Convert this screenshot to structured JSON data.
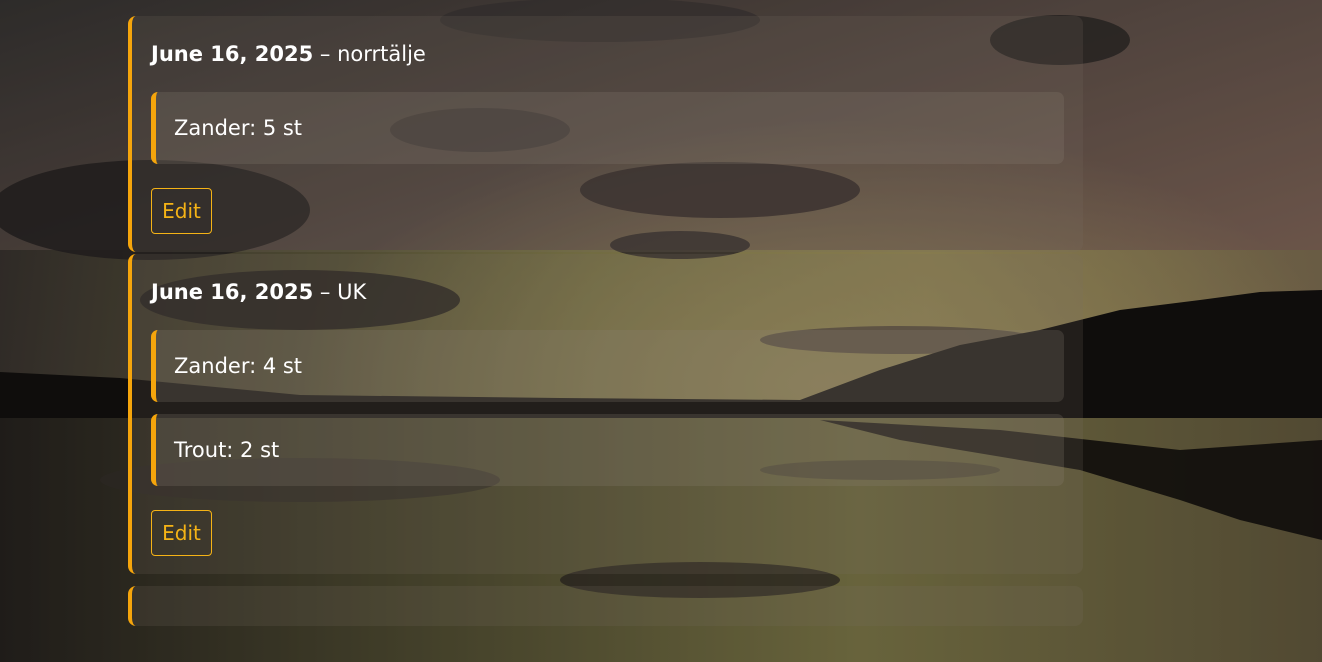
{
  "trips": [
    {
      "date": "June 16, 2025",
      "separator": " – ",
      "location": "norrtälje",
      "catches": [
        {
          "label": "Zander: 5 st"
        }
      ],
      "edit_label": "Edit"
    },
    {
      "date": "June 16, 2025",
      "separator": " – ",
      "location": "UK",
      "catches": [
        {
          "label": "Zander: 4 st"
        },
        {
          "label": "Trout: 2 st"
        }
      ],
      "edit_label": "Edit"
    }
  ],
  "colors": {
    "accent": "#f5a50c",
    "edit_text": "#f5b316"
  }
}
